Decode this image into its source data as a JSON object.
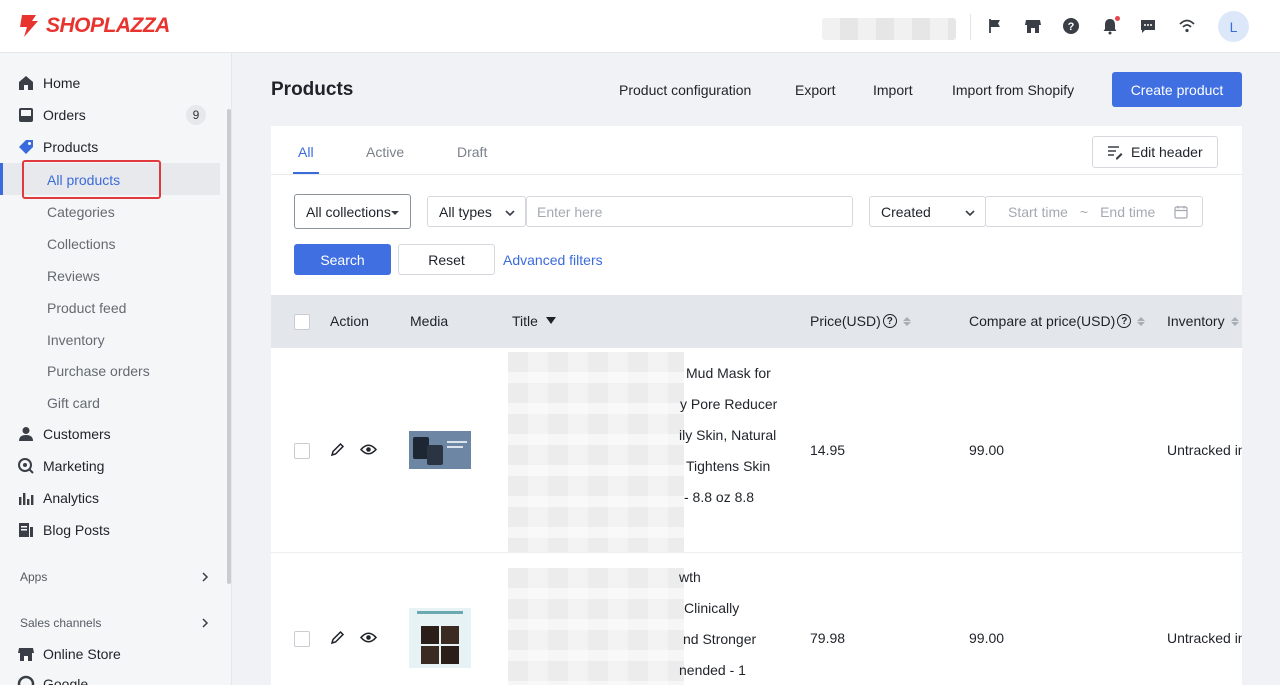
{
  "brand": {
    "name": "SHOPLAZZA",
    "color": "#e8342e"
  },
  "topbar": {
    "icons": [
      "flag-icon",
      "store-icon",
      "help-icon",
      "bell-icon",
      "chat-icon",
      "wifi-icon"
    ],
    "avatar_initial": "L"
  },
  "sidebar": {
    "items": [
      {
        "label": "Home",
        "icon": "home-icon"
      },
      {
        "label": "Orders",
        "icon": "orders-icon",
        "badge": "9"
      },
      {
        "label": "Products",
        "icon": "tag-icon"
      },
      {
        "label": "Customers",
        "icon": "person-icon"
      },
      {
        "label": "Marketing",
        "icon": "marketing-icon"
      },
      {
        "label": "Analytics",
        "icon": "analytics-icon"
      },
      {
        "label": "Blog Posts",
        "icon": "blog-icon"
      },
      {
        "label": "Online Store",
        "icon": "store-icon"
      },
      {
        "label": "Google",
        "icon": "google-icon"
      }
    ],
    "products_sub": [
      {
        "label": "All products",
        "active": true
      },
      {
        "label": "Categories"
      },
      {
        "label": "Collections"
      },
      {
        "label": "Reviews"
      },
      {
        "label": "Product feed"
      },
      {
        "label": "Inventory"
      },
      {
        "label": "Purchase orders"
      },
      {
        "label": "Gift card"
      }
    ],
    "sections": {
      "apps": "Apps",
      "sales_channels": "Sales channels"
    },
    "accent": "#3a6bdc"
  },
  "main": {
    "title": "Products",
    "header_actions": {
      "config": "Product configuration",
      "export": "Export",
      "import": "Import",
      "import_shopify": "Import from Shopify",
      "create": "Create product"
    },
    "tabs": [
      {
        "label": "All",
        "active": true
      },
      {
        "label": "Active"
      },
      {
        "label": "Draft"
      }
    ],
    "edit_header": "Edit header",
    "filters": {
      "collections": "All collections",
      "types": "All types",
      "search_placeholder": "Enter here",
      "date_type": "Created",
      "start_placeholder": "Start time",
      "range_sep": "~",
      "end_placeholder": "End time",
      "search_btn": "Search",
      "reset_btn": "Reset",
      "advanced": "Advanced filters"
    },
    "table": {
      "columns": {
        "action": "Action",
        "media": "Media",
        "title": "Title",
        "price": "Price(USD)",
        "compare": "Compare at price(USD)",
        "inventory": "Inventory"
      },
      "rows": [
        {
          "title_lines": [
            "Mud Mask for",
            "y Pore Reducer",
            "ily Skin, Natural",
            "Tightens Skin",
            "- 8.8 oz 8.8"
          ],
          "price": "14.95",
          "compare": "99.00",
          "inventory": "Untracked in"
        },
        {
          "title_lines": [
            "wth",
            "Clinically",
            "nd Stronger",
            "nended - 1"
          ],
          "price": "79.98",
          "compare": "99.00",
          "inventory": "Untracked in"
        }
      ]
    }
  }
}
